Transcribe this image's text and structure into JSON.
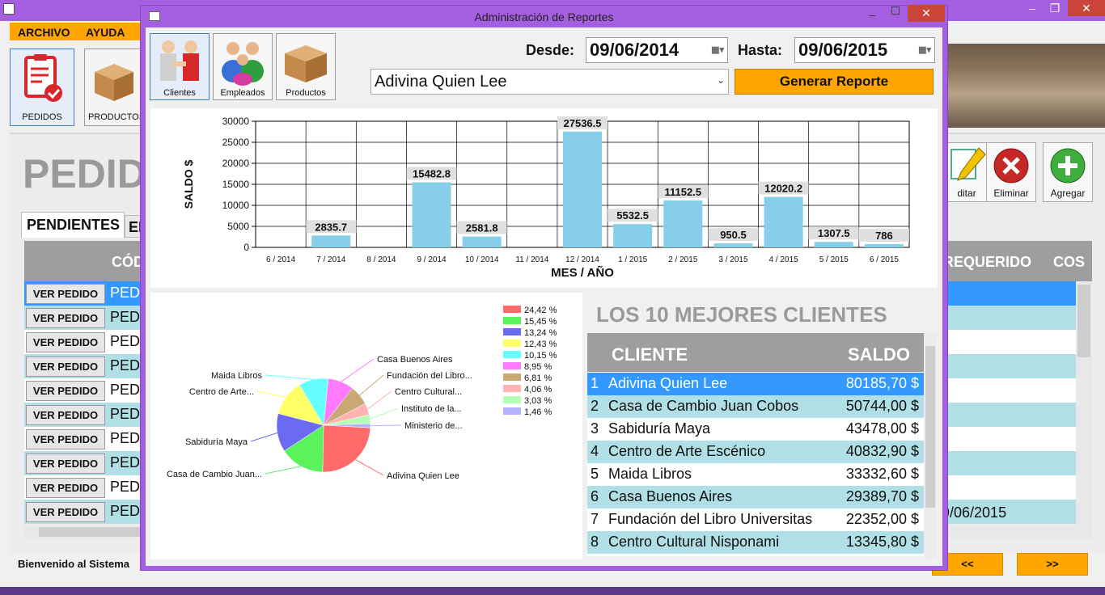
{
  "app": {
    "menu": [
      "ARCHIVO",
      "AYUDA"
    ],
    "tools": [
      {
        "label": "PEDIDOS",
        "icon": "clipboard-check-icon"
      },
      {
        "label": "PRODUCTOS",
        "icon": "boxes-icon"
      }
    ],
    "page_title": "PEDID",
    "tabs": [
      "PENDIENTES",
      "EN"
    ],
    "grid": {
      "headers": {
        "codigo": "CÓD",
        "requerido": "REQUERIDO",
        "cos": "COS"
      },
      "rows": [
        {
          "button": "VER PEDIDO",
          "code": "PED",
          "selected": true
        },
        {
          "button": "VER PEDIDO",
          "code": "PED",
          "selected": false
        },
        {
          "button": "VER PEDIDO",
          "code": "PED",
          "selected": false
        },
        {
          "button": "VER PEDIDO",
          "code": "PED",
          "selected": false
        },
        {
          "button": "VER PEDIDO",
          "code": "PED",
          "selected": false
        },
        {
          "button": "VER PEDIDO",
          "code": "PED",
          "selected": false
        },
        {
          "button": "VER PEDIDO",
          "code": "PED",
          "selected": false
        },
        {
          "button": "VER PEDIDO",
          "code": "PED",
          "selected": false
        },
        {
          "button": "VER PEDIDO",
          "code": "PED",
          "selected": false
        },
        {
          "button": "VER PEDIDO",
          "code": "PED",
          "selected": false
        }
      ],
      "partial_date": "9/06/2015"
    },
    "actions": [
      {
        "label": "ditar",
        "icon": "edit-pencil-icon"
      },
      {
        "label": "Eliminar",
        "icon": "delete-x-icon"
      },
      {
        "label": "Agregar",
        "icon": "add-plus-icon"
      }
    ],
    "status": "Bienvenido al Sistema",
    "nav": {
      "prev": "<<",
      "next": ">>"
    }
  },
  "dialog": {
    "title": "Administración de Reportes",
    "buttons": [
      {
        "label": "Clientes",
        "icon": "clients-handshake-icon"
      },
      {
        "label": "Empleados",
        "icon": "employees-group-icon"
      },
      {
        "label": "Productos",
        "icon": "boxes-icon"
      }
    ],
    "desde_label": "Desde:",
    "desde_value": "09/06/2014",
    "hasta_label": "Hasta:",
    "hasta_value": "09/06/2015",
    "selected_client": "Adivina Quien Lee",
    "generate_button": "Generar Reporte",
    "top10": {
      "title": "LOS 10 MEJORES CLIENTES",
      "headers": {
        "cliente": "CLIENTE",
        "saldo": "SALDO"
      },
      "rows": [
        {
          "n": "1",
          "cliente": "Adivina Quien Lee",
          "saldo": "80185,70 $"
        },
        {
          "n": "2",
          "cliente": "Casa de Cambio Juan Cobos",
          "saldo": "50744,00 $"
        },
        {
          "n": "3",
          "cliente": "Sabiduría Maya",
          "saldo": "43478,00 $"
        },
        {
          "n": "4",
          "cliente": "Centro de Arte Escénico",
          "saldo": "40832,90 $"
        },
        {
          "n": "5",
          "cliente": "Maida Libros",
          "saldo": "33332,60 $"
        },
        {
          "n": "6",
          "cliente": "Casa Buenos Aires",
          "saldo": "29389,70 $"
        },
        {
          "n": "7",
          "cliente": "Fundación del Libro Universitas",
          "saldo": "22352,00 $"
        },
        {
          "n": "8",
          "cliente": "Centro Cultural Nisponami",
          "saldo": "13345,80 $"
        }
      ]
    }
  },
  "chart_data": [
    {
      "type": "bar",
      "xlabel": "MES / AÑO",
      "ylabel": "SALDO $",
      "ylim": [
        0,
        30000
      ],
      "yticks": [
        "0",
        "5000",
        "10000",
        "15000",
        "20000",
        "25000",
        "30000"
      ],
      "categories": [
        "6 / 2014",
        "7 / 2014",
        "8 / 2014",
        "9 / 2014",
        "10 / 2014",
        "11 / 2014",
        "12 / 2014",
        "1 / 2015",
        "2 / 2015",
        "3 / 2015",
        "4 / 2015",
        "5 / 2015",
        "6 / 2015"
      ],
      "values": [
        0,
        2835.7,
        0,
        15482.8,
        2581.8,
        0,
        27536.5,
        5532.5,
        11152.5,
        950.5,
        12020.2,
        1307.5,
        786
      ],
      "labels": [
        "",
        "2835.7",
        "",
        "15482.8",
        "2581.8",
        "",
        "27536.5",
        "5532.5",
        "11152.5",
        "950.5",
        "12020.2",
        "1307.5",
        "786"
      ],
      "bar_color": "#87ceeb",
      "grid": true
    },
    {
      "type": "pie",
      "slices": [
        {
          "name": "Adivina Quien Lee",
          "value": 24.42,
          "legend": "24,42 %",
          "color": "#ff6b6b"
        },
        {
          "name": "Casa de Cambio Juan...",
          "value": 15.45,
          "legend": "15,45 %",
          "color": "#5cf25c"
        },
        {
          "name": "Sabiduría Maya",
          "value": 13.24,
          "legend": "13,24 %",
          "color": "#6a6af2"
        },
        {
          "name": "Centro de Arte...",
          "value": 12.43,
          "legend": "12,43 %",
          "color": "#ffff66"
        },
        {
          "name": "Maida Libros",
          "value": 10.15,
          "legend": "10,15 %",
          "color": "#66ffff"
        },
        {
          "name": "Casa Buenos Aires",
          "value": 8.95,
          "legend": "8,95 %",
          "color": "#ff7aff"
        },
        {
          "name": "Fundación del Libro...",
          "value": 6.81,
          "legend": "6,81 %",
          "color": "#c8a873"
        },
        {
          "name": "Centro Cultural...",
          "value": 4.06,
          "legend": "4,06 %",
          "color": "#ffb3b3"
        },
        {
          "name": "Instituto de la...",
          "value": 3.03,
          "legend": "3,03 %",
          "color": "#b3ffb3"
        },
        {
          "name": "Ministerio de...",
          "value": 1.46,
          "legend": "1,46 %",
          "color": "#b3b3ff"
        }
      ],
      "legend_position": "top-right"
    }
  ]
}
